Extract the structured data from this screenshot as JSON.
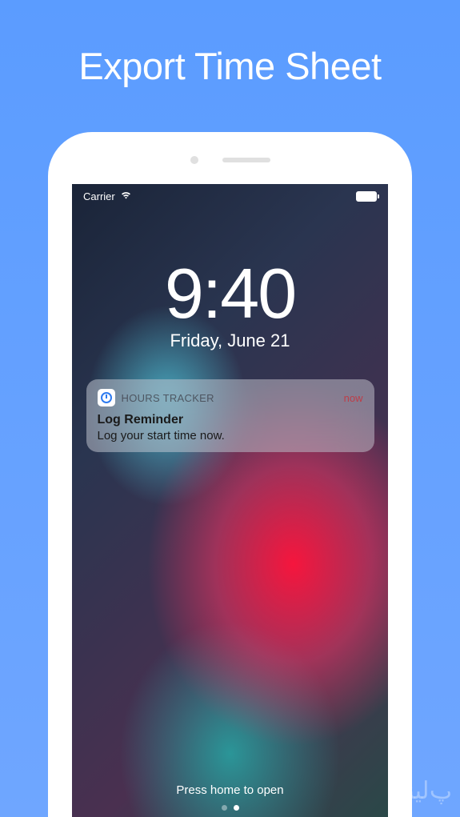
{
  "page": {
    "title": "Export Time Sheet"
  },
  "status_bar": {
    "carrier": "Carrier"
  },
  "lock_screen": {
    "time": "9:40",
    "date": "Friday, June 21",
    "unlock_hint": "Press home to open"
  },
  "notification": {
    "app_name": "HOURS TRACKER",
    "timestamp": "now",
    "title": "Log Reminder",
    "body": "Log your start time now."
  }
}
